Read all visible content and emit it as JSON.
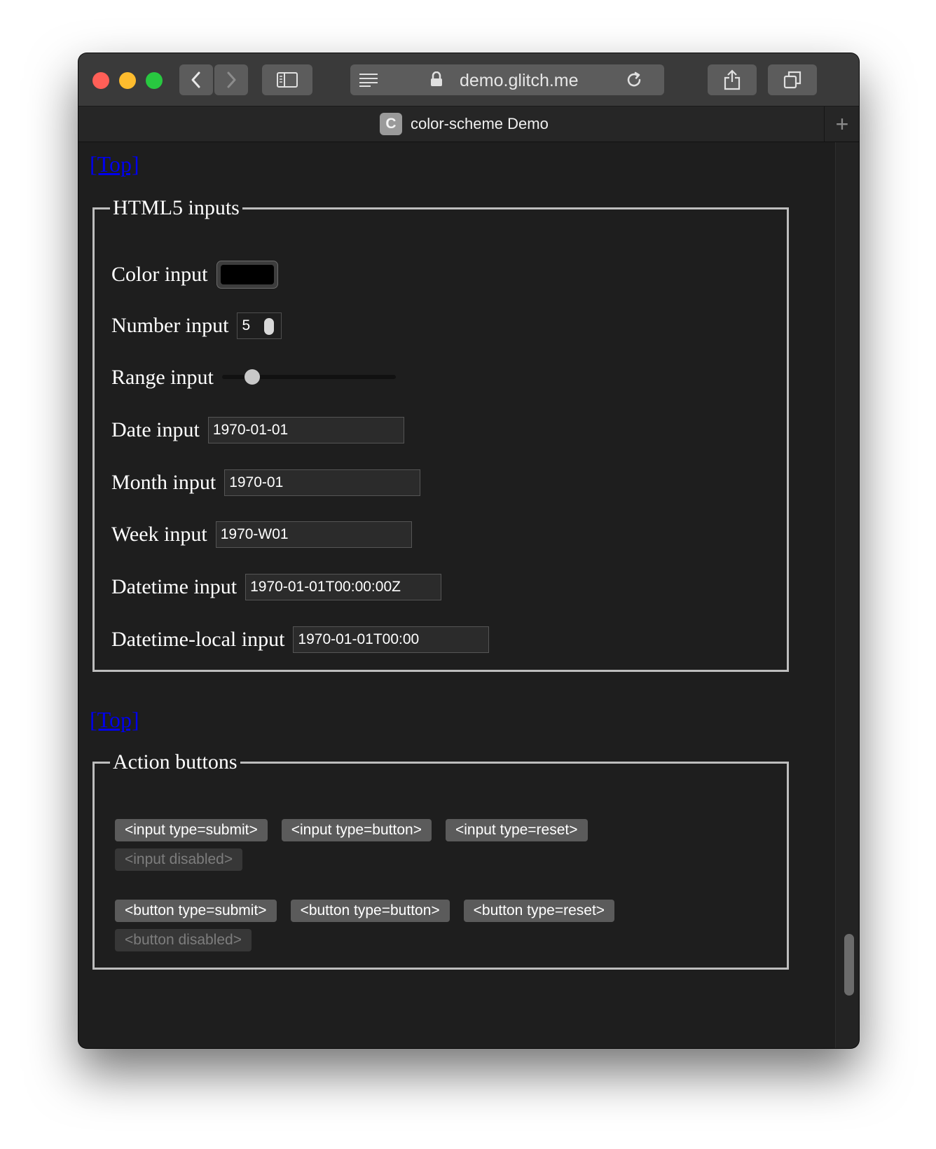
{
  "browser": {
    "url": "demo.glitch.me",
    "tab_title": "color-scheme Demo",
    "favicon_letter": "C",
    "icons": {
      "back": "chevron-left-icon",
      "forward": "chevron-right-icon",
      "sidebar": "sidebar-icon",
      "reader": "reader-icon",
      "lock": "lock-icon",
      "reload": "reload-icon",
      "share": "share-icon",
      "tabs": "tab-overview-icon",
      "new_tab": "plus-icon"
    },
    "colors": {
      "close": "#ff5f57",
      "minimize": "#febc2e",
      "zoom": "#28c840"
    }
  },
  "page": {
    "top_link": "[Top]",
    "html5_inputs": {
      "legend": "HTML5 inputs",
      "color_label": "Color input",
      "color_value": "#000000",
      "number_label": "Number input",
      "number_value": "5",
      "range_label": "Range input",
      "range_fraction": 0.14,
      "date_label": "Date input",
      "date_value": "1970-01-01",
      "month_label": "Month input",
      "month_value": "1970-01",
      "week_label": "Week input",
      "week_value": "1970-W01",
      "datetime_label": "Datetime input",
      "datetime_value": "1970-01-01T00:00:00Z",
      "datetime_local_label": "Datetime-local input",
      "datetime_local_value": "1970-01-01T00:00"
    },
    "action_buttons": {
      "legend": "Action buttons",
      "input_submit": "<input type=submit>",
      "input_button": "<input type=button>",
      "input_reset": "<input type=reset>",
      "input_disabled": "<input disabled>",
      "button_submit": "<button type=submit>",
      "button_button": "<button type=button>",
      "button_reset": "<button type=reset>",
      "button_disabled": "<button disabled>"
    }
  }
}
